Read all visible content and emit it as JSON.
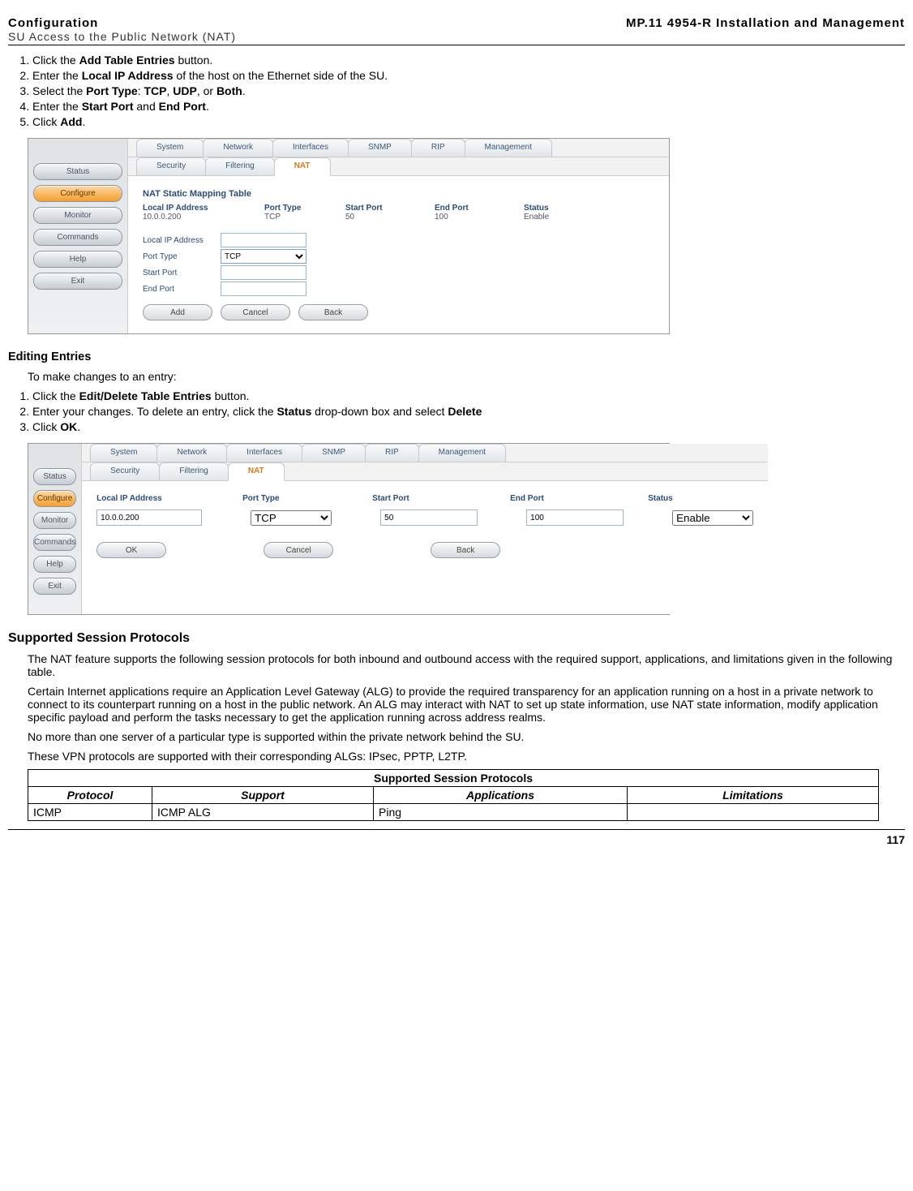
{
  "header": {
    "leftTop": "Configuration",
    "leftSub": "SU Access to the Public Network (NAT)",
    "right": "MP.11 4954-R Installation and Management"
  },
  "steps1": {
    "s1a": "Click the ",
    "s1b": "Add Table Entries",
    "s1c": " button.",
    "s2a": "Enter the ",
    "s2b": "Local IP Address",
    "s2c": " of the host on the Ethernet side of the SU.",
    "s3a": "Select the ",
    "s3b": "Port Type",
    "s3c": ": ",
    "s3d": "TCP",
    "s3e": ", ",
    "s3f": "UDP",
    "s3g": ", or ",
    "s3h": "Both",
    "s3i": ".",
    "s4a": "Enter the ",
    "s4b": "Start Port",
    "s4c": " and ",
    "s4d": "End Port",
    "s4e": ".",
    "s5a": "Click ",
    "s5b": "Add",
    "s5c": "."
  },
  "shot1": {
    "sidebar": [
      "Status",
      "Configure",
      "Monitor",
      "Commands",
      "Help",
      "Exit"
    ],
    "tabsTop": [
      "System",
      "Network",
      "Interfaces",
      "SNMP",
      "RIP",
      "Management"
    ],
    "tabsSub": [
      "Security",
      "Filtering",
      "NAT"
    ],
    "title": "NAT Static Mapping Table",
    "cols": {
      "ip": "Local IP Address",
      "pt": "Port Type",
      "sp": "Start Port",
      "ep": "End Port",
      "st": "Status"
    },
    "vals": {
      "ip": "10.0.0.200",
      "pt": "TCP",
      "sp": "50",
      "ep": "100",
      "st": "Enable"
    },
    "form": {
      "lIp": "Local IP Address",
      "lPt": "Port Type",
      "ptOpt": "TCP",
      "lSp": "Start Port",
      "lEp": "End Port"
    },
    "buttons": {
      "add": "Add",
      "cancel": "Cancel",
      "back": "Back"
    }
  },
  "editHeading": "Editing Entries",
  "editIntro": "To make changes to an entry:",
  "steps2": {
    "s1a": "Click the ",
    "s1b": "Edit/Delete Table Entries",
    "s1c": " button.",
    "s2a": "Enter your changes. To delete an entry, click the ",
    "s2b": "Status",
    "s2c": " drop-down box and select ",
    "s2d": "Delete",
    "s3a": "Click ",
    "s3b": "OK",
    "s3c": "."
  },
  "shot2": {
    "sidebar": [
      "Status",
      "Configure",
      "Monitor",
      "Commands",
      "Help",
      "Exit"
    ],
    "tabsTop": [
      "System",
      "Network",
      "Interfaces",
      "SNMP",
      "RIP",
      "Management"
    ],
    "tabsSub": [
      "Security",
      "Filtering",
      "NAT"
    ],
    "cols": {
      "ip": "Local IP Address",
      "pt": "Port Type",
      "sp": "Start Port",
      "ep": "End Port",
      "st": "Status"
    },
    "row": {
      "ip": "10.0.0.200",
      "pt": "TCP",
      "sp": "50",
      "ep": "100",
      "st": "Enable"
    },
    "buttons": {
      "ok": "OK",
      "cancel": "Cancel",
      "back": "Back"
    }
  },
  "protoHeading": "Supported Session Protocols",
  "protoP1": "The NAT feature supports the following session protocols for both inbound and outbound access with the required support, applications, and limitations given in the following table.",
  "protoP2": "Certain Internet applications require an Application Level Gateway (ALG) to provide the required transparency for an application running on a host in a private network to connect to its counterpart running on a host in the public network. An ALG may interact with NAT to set up state information, use NAT state information, modify application specific payload and perform the tasks necessary to get the application running across address realms.",
  "protoP3": "No more than one server of a particular type is supported within the private network behind the SU.",
  "protoP4": "These VPN protocols are supported with their corresponding ALGs: IPsec, PPTP, L2TP.",
  "table": {
    "caption": "Supported Session Protocols",
    "h1": "Protocol",
    "h2": "Support",
    "h3": "Applications",
    "h4": "Limitations",
    "r1c1": "ICMP",
    "r1c2": "ICMP ALG",
    "r1c3": "Ping",
    "r1c4": ""
  },
  "pageNum": "117"
}
